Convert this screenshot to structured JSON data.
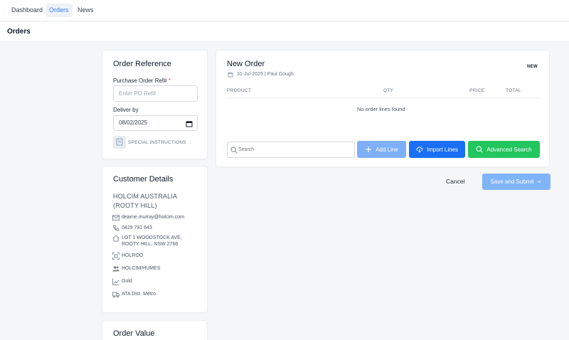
{
  "nav": {
    "items": [
      {
        "label": "Dashboard"
      },
      {
        "label": "Orders"
      },
      {
        "label": "News"
      }
    ]
  },
  "page": {
    "title": "Orders"
  },
  "order_reference": {
    "title": "Order Reference",
    "po_label": "Purchase Order Ref#",
    "po_required": "*",
    "po_placeholder": "Enter PO Ref#",
    "deliver_label": "Deliver by",
    "deliver_value": "08/02/2025",
    "special_instructions": "SPECIAL INSTRUCTIONS"
  },
  "customer": {
    "title": "Customer Details",
    "name_line1": "HOLCIM AUSTRALIA",
    "name_line2": "(ROOTY HILL)",
    "email": "dearne.murray@holcim.com",
    "phone": "0429 791 643",
    "address_line1": "LOT 1 WOODSTOCK AVE,",
    "address_line2": "ROOTY HILL, NSW 2766",
    "code": "HOLROO",
    "group": "HOLCIM/HUMES",
    "tier": "Gold",
    "delivery": "ATA Dist. Metro"
  },
  "order_value": {
    "title": "Order Value"
  },
  "new_order": {
    "title": "New Order",
    "badge": "NEW",
    "meta": "31-Jul-2025 | Paul Gough",
    "columns": [
      "PRODUCT",
      "QTY",
      "PRICE",
      "TOTAL"
    ],
    "empty_text": "No order lines found",
    "search_placeholder": "Search",
    "add_line": "Add Line",
    "import_lines": "Import Lines",
    "advanced_search": "Advanced Search"
  },
  "actions": {
    "cancel": "Cancel",
    "save_submit": "Save and Submit"
  },
  "colors": {
    "accent": "#3b82f6",
    "add_line_bg": "#7eb0f8",
    "import_bg": "#1a6ff5",
    "advanced_bg": "#22c55e",
    "save_bg": "#80b4f8"
  }
}
